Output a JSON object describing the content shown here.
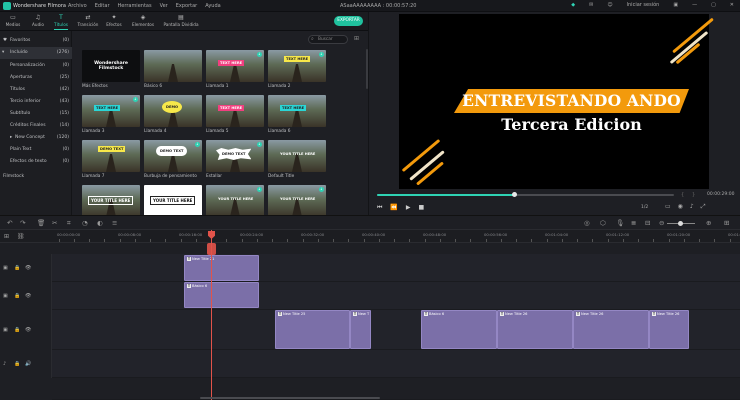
{
  "titlebar": {
    "app_name": "Wondershare Filmora",
    "menus": [
      "Archivo",
      "Editar",
      "Herramientas",
      "Ver",
      "Exportar",
      "Ayuda"
    ],
    "project": "ASaaAAAAAAAA : 00:00:57:20",
    "login": "Iniciar sesión"
  },
  "toolbar": {
    "tabs": [
      {
        "label": "Medios",
        "icon": "▭"
      },
      {
        "label": "Audio",
        "icon": "♫"
      },
      {
        "label": "Títulos",
        "icon": "T"
      },
      {
        "label": "Transición",
        "icon": "⇄"
      },
      {
        "label": "Efectos",
        "icon": "✦"
      },
      {
        "label": "Elementos",
        "icon": "◈"
      },
      {
        "label": "Pantalla Dividida",
        "icon": "▤"
      }
    ],
    "export_label": "EXPORTAR"
  },
  "sidebar": {
    "items": [
      {
        "label": "Favoritos",
        "count": "(0)"
      },
      {
        "label": "Incluido",
        "count": "(276)"
      },
      {
        "label": "Personalización",
        "count": "(0)"
      },
      {
        "label": "Aperturas",
        "count": "(25)"
      },
      {
        "label": "Títulos",
        "count": "(42)"
      },
      {
        "label": "Tercio inferior",
        "count": "(43)"
      },
      {
        "label": "Subtítulo",
        "count": "(15)"
      },
      {
        "label": "Créditos Finales",
        "count": "(14)"
      },
      {
        "label": "New Concept",
        "count": "(120)"
      },
      {
        "label": "Plain Text",
        "count": "(0)"
      },
      {
        "label": "Efectos de texto",
        "count": "(0)"
      },
      {
        "label": "Filmstock",
        "count": ""
      }
    ]
  },
  "library": {
    "search_placeholder": "Buscar",
    "thumbs": [
      {
        "label": "Más Efectos",
        "badge": "Wondershare Filmstock",
        "style": "filmstock"
      },
      {
        "label": "Básico 6",
        "badge": "",
        "style": "plain"
      },
      {
        "label": "Llamada 1",
        "badge": "TEXT HERE",
        "style": "pink"
      },
      {
        "label": "Llamada 2",
        "badge": "TEXT HERE",
        "style": "yellow"
      },
      {
        "label": "Llamada 3",
        "badge": "TEXT HERE",
        "style": "cyan"
      },
      {
        "label": "Llamada 4",
        "badge": "DEMO",
        "style": "yellowcircle"
      },
      {
        "label": "Llamada 5",
        "badge": "TEXT HERE",
        "style": "pink"
      },
      {
        "label": "Llamada 6",
        "badge": "TEXT HERE",
        "style": "cyan"
      },
      {
        "label": "Llamada 7",
        "badge": "DEMO TEXT",
        "style": "yellow"
      },
      {
        "label": "Burbuja de pensamiento",
        "badge": "DEMO TEXT",
        "style": "cloud"
      },
      {
        "label": "Estallar",
        "badge": "DEMO TEXT",
        "style": "burst"
      },
      {
        "label": "Default Title",
        "badge": "YOUR TITLE HERE",
        "style": "plaintext"
      },
      {
        "label": "",
        "badge": "YOUR TITLE HERE",
        "style": "outline"
      },
      {
        "label": "",
        "badge": "YOUR TITLE HERE",
        "style": "white"
      },
      {
        "label": "",
        "badge": "YOUR TITLE HERE",
        "style": "plaintext"
      },
      {
        "label": "",
        "badge": "YOUR TITLE HERE",
        "style": "plaintext"
      }
    ]
  },
  "preview": {
    "title_line1": "ENTREVISTANDO ANDO",
    "title_line2": "Tercera Edicion",
    "progress": 0.46,
    "timecode": "00:00:29:00",
    "quality": "1/2",
    "colors": {
      "banner": "#f39a0c",
      "accent": "#2fd3b4"
    }
  },
  "timeline": {
    "ruler": [
      "00:00:00:00",
      "00:00:08:00",
      "00:00:16:00",
      "00:00:24:00",
      "00:00:32:00",
      "00:00:40:00",
      "00:00:48:00",
      "00:00:56:00",
      "00:01:04:00",
      "00:01:12:00",
      "00:01:20:00",
      "00:01:28:00"
    ],
    "tracks": [
      {
        "clips": [
          {
            "label": "New Title 21"
          }
        ]
      },
      {
        "clips": [
          {
            "label": "Básico 6"
          }
        ]
      },
      {
        "clips": [
          {
            "label": "New Title 25"
          },
          {
            "label": "New T"
          },
          {
            "label": "Básico 6"
          },
          {
            "label": "New Title 26"
          },
          {
            "label": "New Title 26"
          },
          {
            "label": "New Title 26"
          }
        ]
      }
    ]
  }
}
